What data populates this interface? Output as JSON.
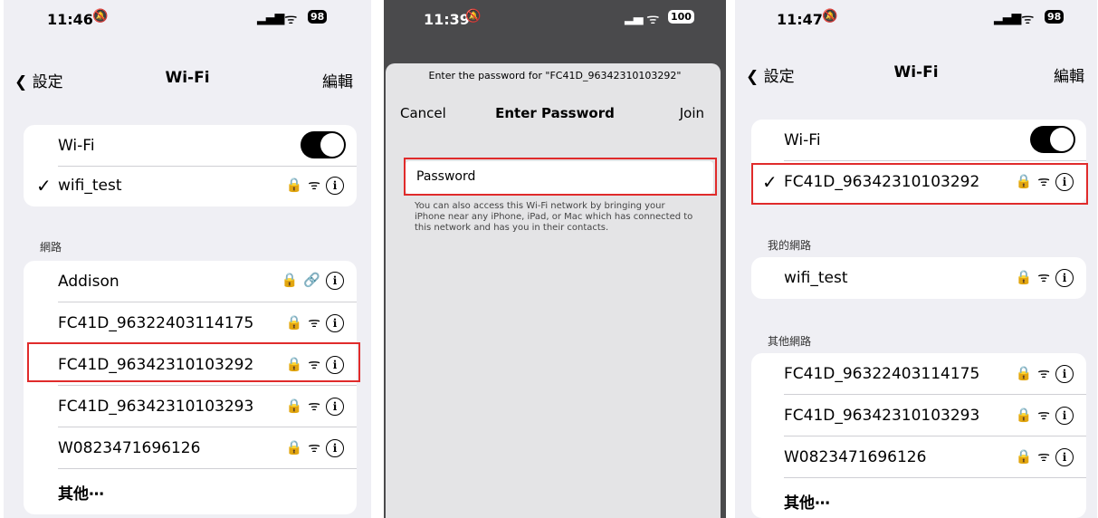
{
  "panel1": {
    "status": {
      "time": "11:46",
      "bell": "🔕",
      "signal": "▂▄▆",
      "wifi": "ᯤ",
      "battery": "98"
    },
    "nav": {
      "back": "設定",
      "title": "Wi-Fi",
      "edit": "編輯"
    },
    "wifi_label": "Wi-Fi",
    "connected": {
      "check": "✓",
      "name": "wifi_test"
    },
    "section": "網路",
    "networks": [
      "Addison",
      "FC41D_96322403114175",
      "FC41D_96342310103292",
      "FC41D_96342310103293",
      "W0823471696126",
      "其他⋯"
    ]
  },
  "panel2": {
    "status": {
      "time": "11:39",
      "bell": "🔕",
      "signal": "▂▄",
      "wifi": "ᯤ",
      "battery": "100"
    },
    "prompt": "Enter the password for \"FC41D_96342310103292\"",
    "cancel": "Cancel",
    "title": "Enter Password",
    "join": "Join",
    "password_label": "Password",
    "hint": "You can also access this Wi-Fi network by bringing your iPhone near any iPhone, iPad, or Mac which has connected to this network and has you in their contacts."
  },
  "panel3": {
    "status": {
      "time": "11:47",
      "bell": "🔕",
      "signal": "▂▄▆",
      "wifi": "ᯤ",
      "battery": "98"
    },
    "nav": {
      "back": "設定",
      "title": "Wi-Fi",
      "edit": "編輯"
    },
    "wifi_label": "Wi-Fi",
    "connected": {
      "check": "✓",
      "name": "FC41D_96342310103292"
    },
    "my_section": "我的網路",
    "my_networks": [
      "wifi_test"
    ],
    "other_section": "其他網路",
    "other_networks": [
      "FC41D_96322403114175",
      "FC41D_96342310103293",
      "W0823471696126",
      "其他⋯"
    ]
  },
  "icons": {
    "lock": "🔒",
    "wifi": "ᯤ",
    "link": "🔗",
    "info": "i",
    "back": "❮"
  },
  "colors": {
    "highlight": "#e02b2b",
    "toggle_on": "#000000"
  }
}
